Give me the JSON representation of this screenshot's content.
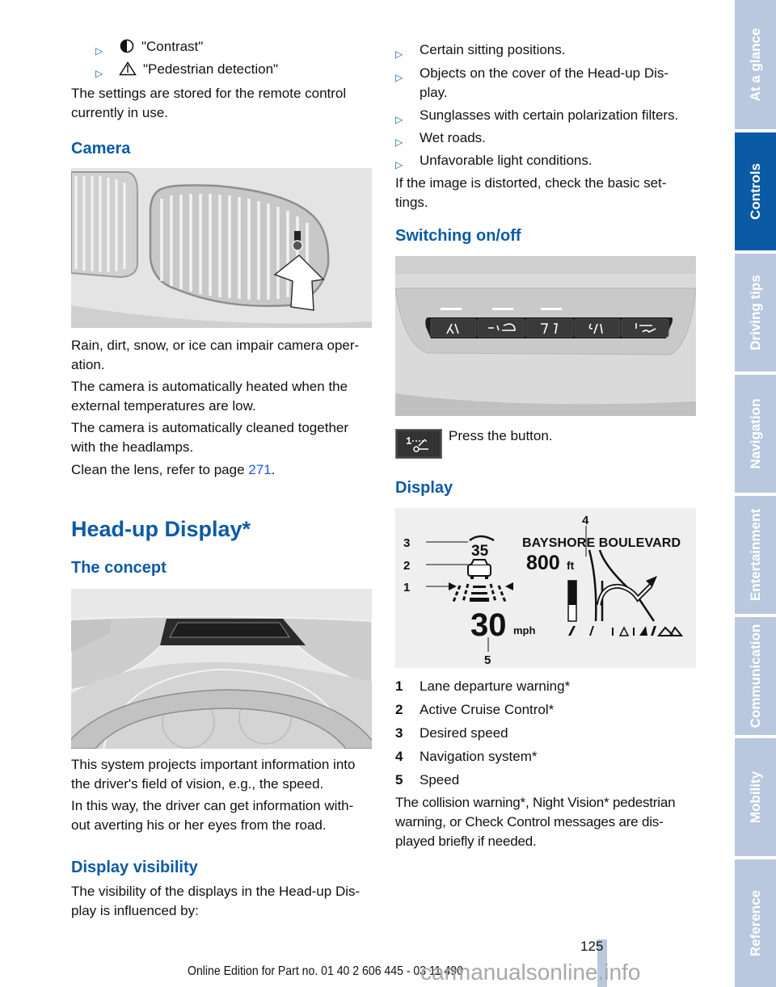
{
  "left": {
    "bullets_top": [
      {
        "icon": "contrast-icon",
        "text": "\"Contrast\""
      },
      {
        "icon": "pedestrian-warning-icon",
        "text": "\"Pedestrian detection\""
      }
    ],
    "settings_note": "The settings are stored for the remote control currently in use.",
    "camera_heading": "Camera",
    "camera_paras": [
      "Rain, dirt, snow, or ice can impair camera oper- ation.",
      "The camera is automatically heated when the external temperatures are low.",
      "The camera is automatically cleaned together with the headlamps."
    ],
    "clean_lens_prefix": "Clean the lens, refer to page ",
    "clean_lens_page": "271",
    "clean_lens_suffix": ".",
    "hud_heading": "Head-up Display*",
    "concept_heading": "The concept",
    "concept_paras": [
      "This system projects important information into the driver's field of vision, e.g., the speed.",
      "In this way, the driver can get information with- out averting his or her eyes from the road."
    ],
    "visibility_heading": "Display visibility",
    "visibility_intro": "The visibility of the displays in the Head-up Dis- play is influenced by:"
  },
  "right": {
    "influences": [
      "Certain sitting positions.",
      "Objects on the cover of the Head-up Dis- play.",
      "Sunglasses with certain polarization filters.",
      "Wet roads.",
      "Unfavorable light conditions."
    ],
    "distorted_note": "If the image is distorted, check the basic set- tings.",
    "switching_heading": "Switching on/off",
    "press_button": "Press the button.",
    "display_heading": "Display",
    "hud_display": {
      "street": "BAYSHORE BOULEVARD",
      "distance": "800",
      "distance_unit": "ft",
      "set_speed": "35",
      "speed": "30",
      "speed_unit": "mph",
      "callouts": [
        "1",
        "2",
        "3",
        "4",
        "5"
      ]
    },
    "legend": [
      {
        "num": "1",
        "text": "Lane departure warning*"
      },
      {
        "num": "2",
        "text": "Active Cruise Control*"
      },
      {
        "num": "3",
        "text": "Desired speed"
      },
      {
        "num": "4",
        "text": "Navigation system*"
      },
      {
        "num": "5",
        "text": "Speed"
      }
    ],
    "closing_note": "The collision warning*, Night Vision* pedestrian warning, or Check Control messages are dis- played briefly if needed."
  },
  "sidebar": {
    "tabs": [
      {
        "label": "At a glance",
        "active": false
      },
      {
        "label": "Controls",
        "active": true
      },
      {
        "label": "Driving tips",
        "active": false
      },
      {
        "label": "Navigation",
        "active": false
      },
      {
        "label": "Entertainment",
        "active": false
      },
      {
        "label": "Communication",
        "active": false
      },
      {
        "label": "Mobility",
        "active": false
      },
      {
        "label": "Reference",
        "active": false
      }
    ]
  },
  "footer": {
    "page_number": "125",
    "edition": "Online Edition for Part no. 01 40 2 606 445 - 03 11 490",
    "watermark": "carmanualsonline.info"
  },
  "colors": {
    "heading_blue": "#0b5aa6",
    "link_blue": "#1a5fc8",
    "tab_inactive": "#b9c8de",
    "tab_active": "#0b5aa6"
  }
}
